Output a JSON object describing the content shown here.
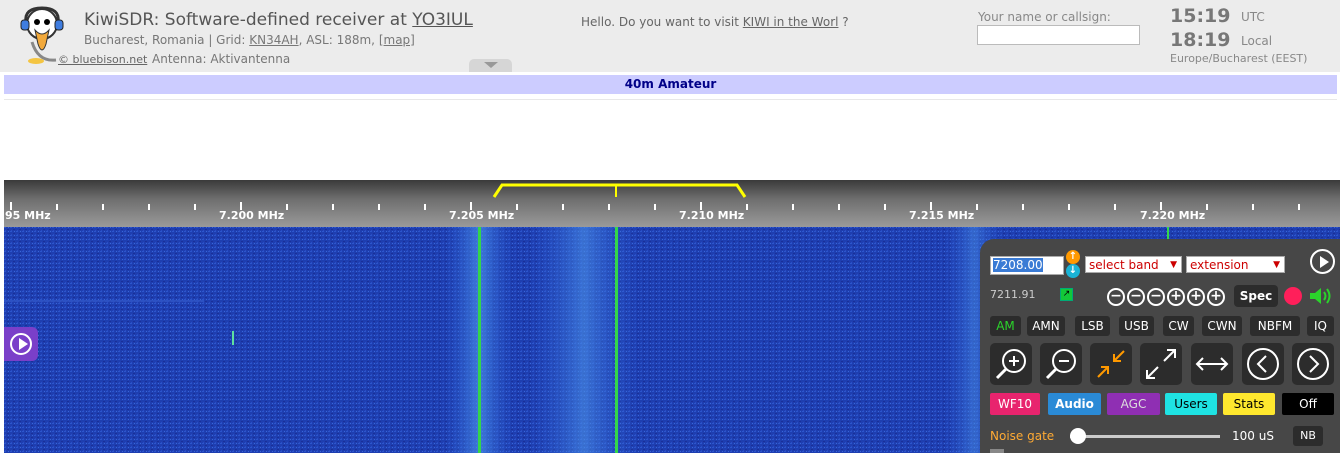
{
  "header": {
    "title_prefix": "KiwiSDR: Software-defined receiver at ",
    "title_owner": "YO3IUL",
    "location_prefix": "Bucharest, Romania | Grid: ",
    "grid": "KN34AH",
    "asl": ", ASL: 188m, ",
    "map_link": "[map]",
    "antenna": "Antenna: Aktivantenna",
    "logo_credit": "© bluebison.net",
    "hello_prefix": "Hello. Do you want to visit ",
    "hello_link": "KIWI in the Worl",
    "hello_suffix": " ?",
    "name_label": "Your name or callsign:",
    "name_value": "",
    "utc_time": "15:19",
    "utc_label": "UTC",
    "local_time": "18:19",
    "local_label": "Local",
    "timezone": "Europe/Bucharest (EEST)"
  },
  "band_name": "40m Amateur",
  "scale": {
    "labels": [
      "95 MHz",
      "7.200 MHz",
      "7.205 MHz",
      "7.210 MHz",
      "7.215 MHz",
      "7.220 MHz"
    ],
    "passband_color": "#ffff00"
  },
  "colors": {
    "waterfall_bg": "#1f3fb2",
    "signal": "#34d64a",
    "panel_bg": "#474747",
    "accent_orange": "#ff9900",
    "record": "#ff1f5a"
  },
  "panel": {
    "frequency": "7208.00",
    "band_select": "select band",
    "extension_select": "extension",
    "readout": "7211.91",
    "spec_label": "Spec",
    "modes": [
      "AM",
      "AMN",
      "LSB",
      "USB",
      "CW",
      "CWN",
      "NBFM",
      "IQ"
    ],
    "active_mode": "AM",
    "tabs": {
      "wf": "WF10",
      "audio": "Audio",
      "agc": "AGC",
      "users": "Users",
      "stats": "Stats",
      "off": "Off"
    },
    "noise_gate_label": "Noise gate",
    "noise_gate_value": "100 uS",
    "noise_gate_level": 0,
    "nb_label": "NB"
  },
  "icons": [
    "logo-duck-icon",
    "play-icon",
    "zoom-in-icon",
    "zoom-out-icon",
    "zoom-fit-icon",
    "expand-icon",
    "swap-icon",
    "arrow-left-icon",
    "arrow-right-icon",
    "record-icon",
    "speaker-icon",
    "frequency-up-icon",
    "frequency-down-icon",
    "external-link-icon"
  ]
}
